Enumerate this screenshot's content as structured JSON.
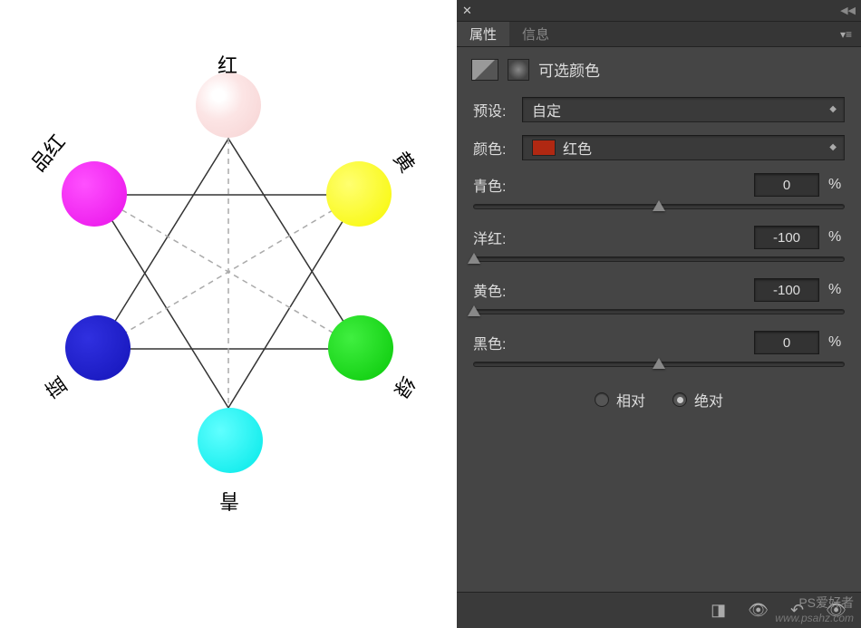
{
  "panel": {
    "tabs": {
      "properties": "属性",
      "info": "信息"
    },
    "adjustment_title": "可选颜色",
    "preset": {
      "label": "预设:",
      "value": "自定"
    },
    "color": {
      "label": "颜色:",
      "value": "红色"
    },
    "sliders": {
      "cyan": {
        "label": "青色:",
        "value": "0",
        "unit": "%",
        "pos": 50
      },
      "magenta": {
        "label": "洋红:",
        "value": "-100",
        "unit": "%",
        "pos": 0
      },
      "yellow": {
        "label": "黄色:",
        "value": "-100",
        "unit": "%",
        "pos": 0
      },
      "black": {
        "label": "黑色:",
        "value": "0",
        "unit": "%",
        "pos": 50
      }
    },
    "radio": {
      "relative": "相对",
      "absolute": "绝对",
      "selected": "absolute"
    }
  },
  "diagram": {
    "labels": {
      "red": "红",
      "yellow": "黄",
      "green": "绿",
      "cyan": "青",
      "blue": "蓝",
      "magenta": "品红"
    }
  },
  "watermark": {
    "cn": "PS爱好者",
    "url": "www.psahz.com"
  }
}
